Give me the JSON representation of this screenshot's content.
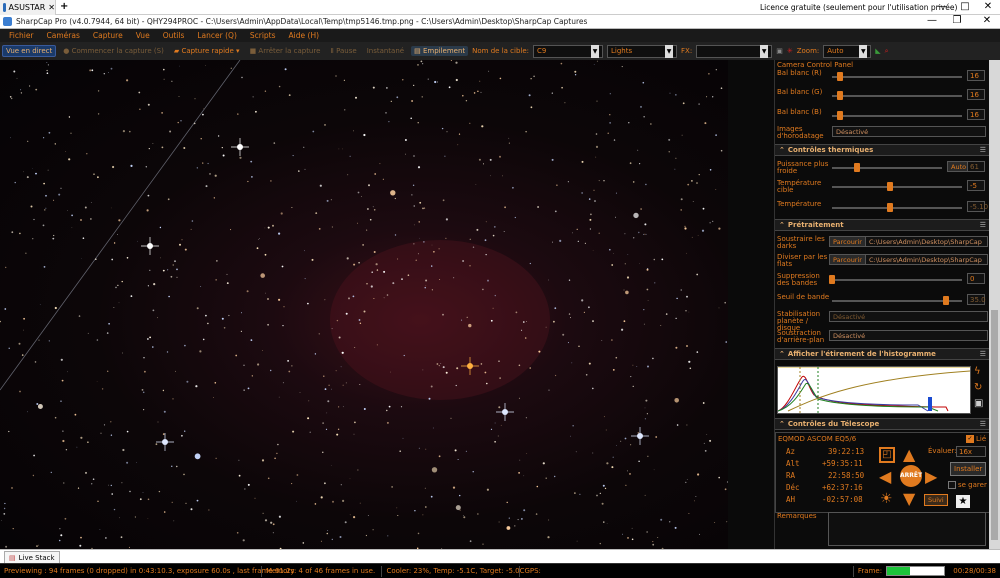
{
  "browser": {
    "tab_title": "ASUSTAR",
    "new_tab": "+",
    "license": "Licence gratuite (seulement pour l'utilisation privée)",
    "controls": [
      "—",
      "□",
      "✕"
    ]
  },
  "titlebar": {
    "title": "SharpCap Pro (v4.0.7944, 64 bit) - QHY294PROC - C:\\Users\\Admin\\AppData\\Local\\Temp\\tmp5146.tmp.png - C:\\Users\\Admin\\Desktop\\SharpCap Captures",
    "controls": [
      "—",
      "❐",
      "✕"
    ]
  },
  "menu": [
    "Fichier",
    "Caméras",
    "Capture",
    "Vue",
    "Outils",
    "Lancer (Q)",
    "Scripts",
    "Aide (H)"
  ],
  "toolbar": {
    "live_view": "Vue en direct",
    "start_capture": "Commencer la capture (S)",
    "quick_capture": "Capture rapide",
    "stop_capture": "Arrêter la capture",
    "pause": "Pause",
    "snapshot": "Instantané",
    "stacking": "Empilement",
    "target_label": "Nom de la cible:",
    "target_value": "C9",
    "frame_type": "Lights",
    "fx_label": "FX:",
    "fx_value": "",
    "zoom_label": "Zoom:",
    "zoom_value": "Auto"
  },
  "panel": {
    "ccp_title": "Camera Control Panel",
    "wb_r_label": "Bal blanc (R)",
    "wb_r": "16",
    "wb_g_label": "Bal blanc (G)",
    "wb_g": "16",
    "wb_b_label": "Bal blanc (B)",
    "wb_b": "16",
    "timestamp_label": "Images d'horodatage",
    "timestamp_value": "Désactivé",
    "thermal_title": "Contrôles thermiques",
    "cooler_label": "Puissance plus froide",
    "cooler_auto": "Auto",
    "cooler_value": "61",
    "target_temp_label": "Température cible",
    "target_temp": "-5",
    "temp_label": "Température",
    "temp_value": "-5.10",
    "preproc_title": "Prétraitement",
    "darks_label": "Soustraire les darks",
    "darks_btn": "Parcourir",
    "darks_path": "C:\\Users\\Admin\\Desktop\\SharpCap",
    "flats_label": "Diviser par les flats",
    "flats_btn": "Parcourir",
    "flats_path": "C:\\Users\\Admin\\Desktop\\SharpCap",
    "banding_label": "Suppression des bandes",
    "banding_value": "0",
    "banding_thresh_label": "Seuil de bande",
    "banding_thresh": "35.0",
    "stab_label": "Stabilisation planète / disque",
    "stab_value": "Désactivé",
    "bg_label": "Soustraction d'arrière-plan",
    "bg_value": "Désactivé",
    "histo_title": "Afficher l'étirement de l'histogramme",
    "tele_title": "Contrôles du Télescope",
    "mount": "EQMOD ASCOM EQ5/6",
    "linked_label": "Lié",
    "az_label": "Az",
    "az": "39:22:13",
    "alt_label": "Alt",
    "alt": "+59:35:11",
    "ra_label": "RA",
    "ra": "22:58:50",
    "dec_label": "Déc",
    "dec": "+62:37:16",
    "ah_label": "AH",
    "ah": "-02:57:08",
    "rate_label": "Évaluer:",
    "rate_value": "16x",
    "stop_btn": "ARRÊT",
    "track_btn": "Suivi",
    "install_btn": "Installer",
    "park_label": "se garer",
    "notes_label": "Remarques"
  },
  "bottom_tab": "Live Stack",
  "status": {
    "preview": "Previewing : 94 frames (0 dropped) in 0:43:10.3, exposure 60.0s , last frame 61.2s",
    "memory": "Memory: 4 of 46 frames in use.",
    "cooler": "Cooler: 23%, Temp: -5.1C, Target: -5.0C",
    "gps": "GPS:",
    "frame_label": "Frame:",
    "frame_progress": 0.4,
    "time": "00:28/00:38"
  },
  "colors": {
    "accent": "#e07a1f",
    "panel_bg": "#0b0b0b",
    "header": "#1c1c1c"
  }
}
